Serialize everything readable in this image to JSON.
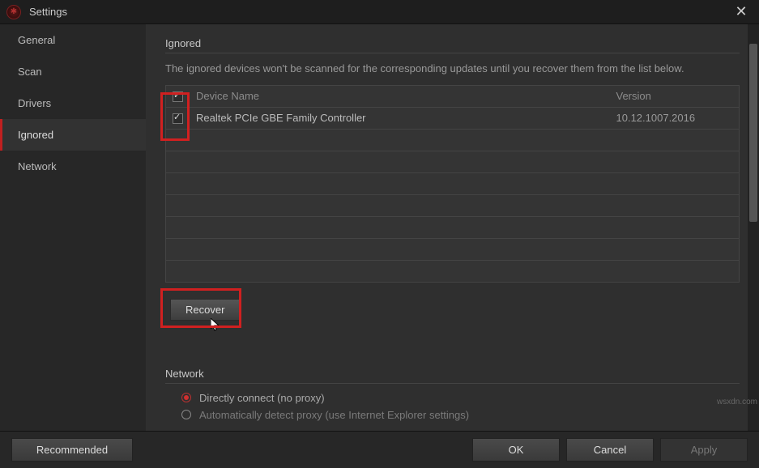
{
  "window": {
    "title": "Settings"
  },
  "sidebar": {
    "items": [
      {
        "label": "General"
      },
      {
        "label": "Scan"
      },
      {
        "label": "Drivers"
      },
      {
        "label": "Ignored"
      },
      {
        "label": "Network"
      }
    ],
    "active": 3
  },
  "ignored": {
    "title": "Ignored",
    "description": "The ignored devices won't be scanned for the corresponding updates until you recover them from the list below.",
    "columns": {
      "device": "Device Name",
      "version": "Version"
    },
    "rows": [
      {
        "checked": true,
        "device": "Realtek PCIe GBE Family Controller",
        "version": "10.12.1007.2016"
      }
    ],
    "recover_label": "Recover"
  },
  "network": {
    "title": "Network",
    "options": [
      {
        "label": "Directly connect (no proxy)",
        "selected": true
      },
      {
        "label": "Automatically detect proxy (use Internet Explorer settings)",
        "selected": false
      }
    ]
  },
  "footer": {
    "recommended": "Recommended",
    "ok": "OK",
    "cancel": "Cancel",
    "apply": "Apply"
  },
  "watermark": "wsxdn.com"
}
